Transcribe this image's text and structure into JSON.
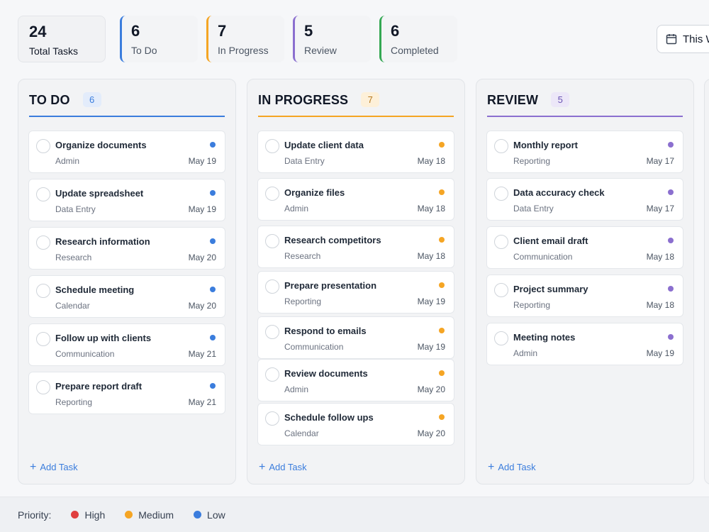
{
  "colors": {
    "todo": "#3b7ddd",
    "in_progress": "#f5a524",
    "review": "#8b6fcf",
    "completed": "#34a853",
    "high": "#e03e3e",
    "medium": "#f5a524",
    "low": "#3b7ddd"
  },
  "stats": {
    "total": {
      "value": "24",
      "label": "Total Tasks"
    },
    "todo": {
      "value": "6",
      "label": "To Do"
    },
    "in_progress": {
      "value": "7",
      "label": "In Progress"
    },
    "review": {
      "value": "5",
      "label": "Review"
    },
    "completed": {
      "value": "6",
      "label": "Completed"
    }
  },
  "date_filter": {
    "label": "This Week",
    "icon": "calendar-icon"
  },
  "columns": [
    {
      "title": "TO DO",
      "count": "6",
      "add_label": "Add Task",
      "tasks": [
        {
          "title": "Organize documents",
          "category": "Admin",
          "date": "May 19"
        },
        {
          "title": "Update spreadsheet",
          "category": "Data Entry",
          "date": "May 19"
        },
        {
          "title": "Research information",
          "category": "Research",
          "date": "May 20"
        },
        {
          "title": "Schedule meeting",
          "category": "Calendar",
          "date": "May 20"
        },
        {
          "title": "Follow up with clients",
          "category": "Communication",
          "date": "May 21"
        },
        {
          "title": "Prepare report draft",
          "category": "Reporting",
          "date": "May 21"
        }
      ]
    },
    {
      "title": "IN PROGRESS",
      "count": "7",
      "add_label": "Add Task",
      "tasks": [
        {
          "title": "Update client data",
          "category": "Data Entry",
          "date": "May 18"
        },
        {
          "title": "Organize files",
          "category": "Admin",
          "date": "May 18"
        },
        {
          "title": "Research competitors",
          "category": "Research",
          "date": "May 18"
        },
        {
          "title": "Prepare presentation",
          "category": "Reporting",
          "date": "May 19"
        },
        {
          "title": "Respond to emails",
          "category": "Communication",
          "date": "May 19"
        },
        {
          "title": "Review documents",
          "category": "Admin",
          "date": "May 20"
        },
        {
          "title": "Schedule follow ups",
          "category": "Calendar",
          "date": "May 20"
        }
      ]
    },
    {
      "title": "REVIEW",
      "count": "5",
      "add_label": "Add Task",
      "tasks": [
        {
          "title": "Monthly report",
          "category": "Reporting",
          "date": "May 17"
        },
        {
          "title": "Data accuracy check",
          "category": "Data Entry",
          "date": "May 17"
        },
        {
          "title": "Client email draft",
          "category": "Communication",
          "date": "May 18"
        },
        {
          "title": "Project summary",
          "category": "Reporting",
          "date": "May 18"
        },
        {
          "title": "Meeting notes",
          "category": "Admin",
          "date": "May 19"
        }
      ]
    }
  ],
  "footer": {
    "label": "Priority:",
    "legend": [
      {
        "label": "High"
      },
      {
        "label": "Medium"
      },
      {
        "label": "Low"
      }
    ]
  }
}
